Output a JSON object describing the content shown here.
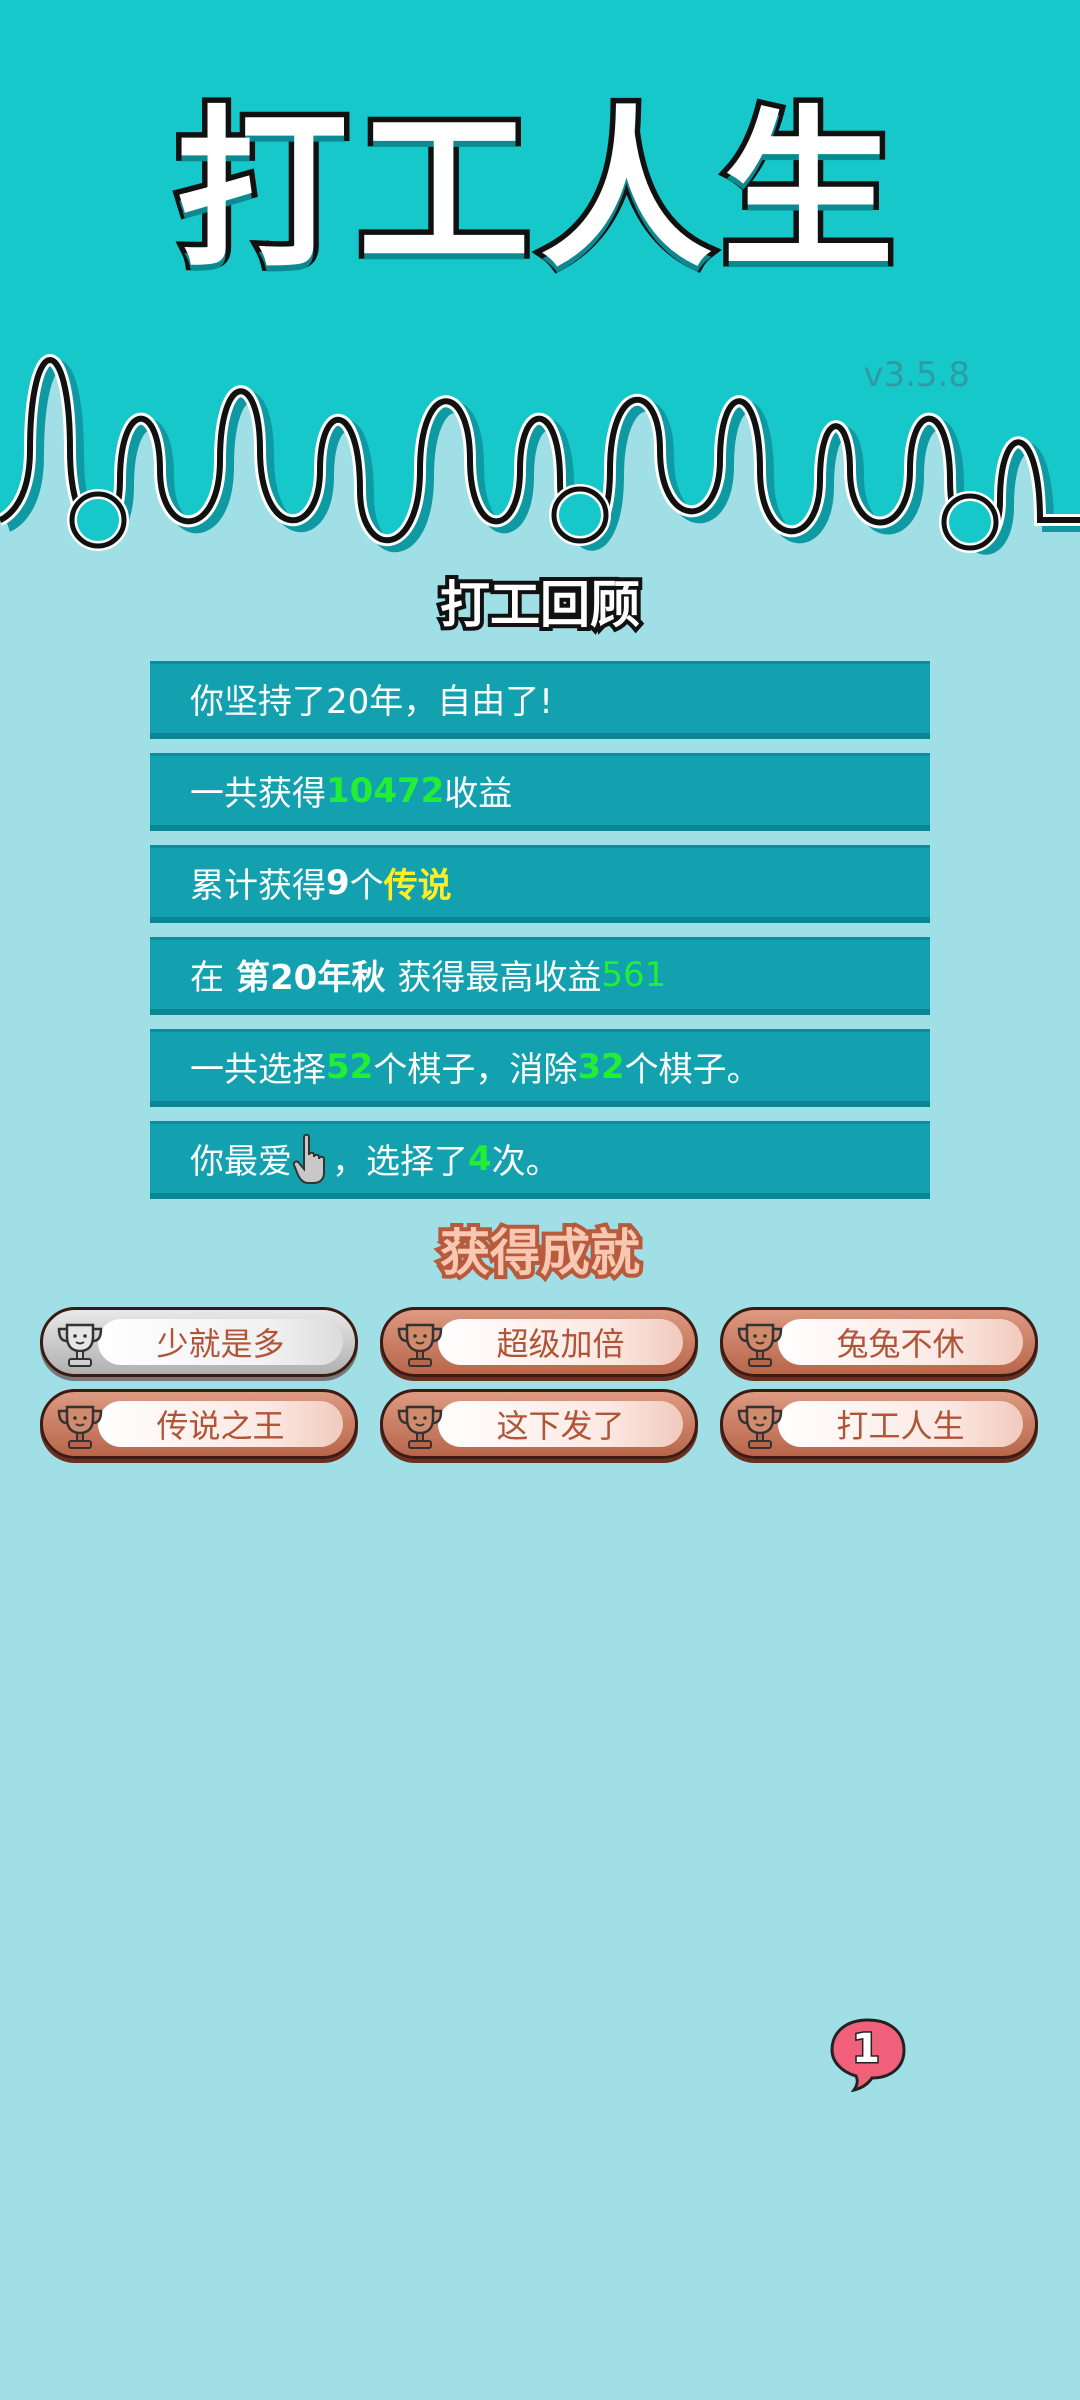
{
  "app": {
    "title": "打工人生",
    "version": "v3.5.8"
  },
  "review": {
    "title": "打工回顾",
    "line1": "你坚持了20年，自由了!",
    "line2": {
      "pre": "一共获得",
      "value": "10472",
      "post": "收益"
    },
    "line3": {
      "pre": "累计获得",
      "count": "9",
      "mid": "个",
      "tag": "传说"
    },
    "line4": {
      "pre": "在",
      "when": "第20年秋",
      "mid": "获得最高收益",
      "value": "561"
    },
    "line5": {
      "pre": "一共选择",
      "chosen": "52",
      "mid": "个棋子，消除",
      "removed": "32",
      "post": "个棋子。"
    },
    "line6": {
      "pre": "你最爱",
      "icon": "pointing-hand-icon",
      "mid": "，选择了",
      "times": "4",
      "post": "次。"
    }
  },
  "achievements": {
    "title": "获得成就",
    "items": [
      {
        "label": "少就是多",
        "tier": "silver"
      },
      {
        "label": "超级加倍",
        "tier": "bronze"
      },
      {
        "label": "兔兔不休",
        "tier": "bronze"
      },
      {
        "label": "传说之王",
        "tier": "bronze"
      },
      {
        "label": "这下发了",
        "tier": "bronze"
      },
      {
        "label": "打工人生",
        "tier": "bronze"
      }
    ]
  },
  "notification": {
    "count": "1"
  },
  "colors": {
    "header": "#17c8cb",
    "background": "#a0dfe6",
    "row": "#13a1af",
    "highlight_green": "#22ee33",
    "highlight_yellow": "#ffee22",
    "badge_bronze": "#c47a5e"
  }
}
